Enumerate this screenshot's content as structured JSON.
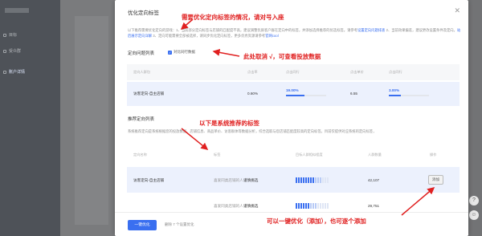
{
  "background": {
    "nav_items": [
      "目标",
      "受众群",
      "账户详情"
    ]
  },
  "modal": {
    "title": "优化定向标签",
    "close_icon": "close-icon",
    "intro_line1": "以下推荐需要优化定向的游戏：1、当前部分定向标签与店铺的匹配度不高，建议调整优质客户群在定向中的标签，并添加选择推荐的优选标签。请参考",
    "intro_link1": "设置定向问题排查",
    "intro_line2": "2、当前效果偏差，建议更改设置条件及定向。",
    "intro_link2": "站后展示定向详解",
    "intro_line3": "3、定向可能需要全部被选择，请同步优化定向标签，更多优秀资源请参考",
    "intro_link3": "官网cool",
    "section1": {
      "title": "定向问题列表",
      "checkbox_label": "对比同行数据",
      "checked": true,
      "headers": [
        "定向人群包",
        "点击率",
        "点击同行",
        "点击单价",
        "点击同行"
      ],
      "row": {
        "name": "访客定向-自主店铺",
        "ctr": "0.60%",
        "ctr_peer": "19.00%",
        "ctr_peer_fill": 0.45,
        "cpc": "6.55",
        "cpc_peer": "3.00%",
        "cpc_peer_fill": 0.3
      }
    },
    "section2": {
      "title": "推荐定向列表",
      "desc": "系统推荐定向是系统根据您的投放数据、店铺信息、商品单价、访客群体等数据分析，综合选取与您店铺匹配度较高的定向标签。目前仅提供对应系统的定向标签，",
      "headers": [
        "定向名称",
        "标签",
        "目标人群相似程度",
        "人群数量",
        "操作"
      ],
      "rows": [
        {
          "name": "访客定向-自主店铺",
          "tag": "喜爱同类店铺的人",
          "tag_suffix": "谨慎挑选",
          "similarity": 0.55,
          "count": "42,107",
          "action": "添加"
        },
        {
          "name": "",
          "tag": "喜爱同类店铺的人",
          "tag_suffix": "谨慎挑选",
          "similarity": 0.4,
          "count": "29,751",
          "action": ""
        }
      ]
    },
    "footer": {
      "primary": "一键优化",
      "text": "删除 7 个设置优化"
    }
  },
  "annotations": {
    "a1": "需要优化定向标签的情况，请对号入座",
    "a2": "此处取消 √，可查看投放数据",
    "a3": "以下是系统推荐的标签",
    "a4": "可以一键优化（添加），也可逐个添加"
  },
  "colors": {
    "accent": "#3a6ff0",
    "annotation": "#e02020"
  }
}
